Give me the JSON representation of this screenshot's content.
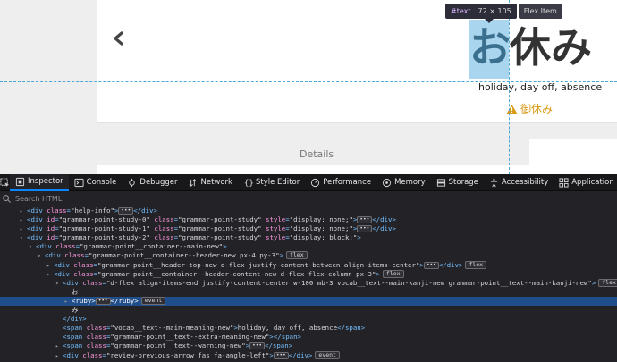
{
  "page": {
    "kanji_highlighted": "お",
    "kanji_rest": "休み",
    "meaning": "holiday, day off, absence",
    "warning_text": "御休み",
    "details_label": "Details",
    "back_icon": "chevron-left-icon",
    "warning_icon": "warning-triangle-icon",
    "colors": {
      "highlight": "#a9d6ee",
      "warning": "#d89a15",
      "guide": "#4aa7d8"
    }
  },
  "tooltip": {
    "node": "#text",
    "dimensions": "72 × 105",
    "flex_label": "Flex Item"
  },
  "devtools": {
    "tabs": [
      {
        "label": "Inspector",
        "icon": "inspector-icon",
        "active": true
      },
      {
        "label": "Console",
        "icon": "console-icon"
      },
      {
        "label": "Debugger",
        "icon": "debugger-icon"
      },
      {
        "label": "Network",
        "icon": "network-icon"
      },
      {
        "label": "Style Editor",
        "icon": "style-editor-icon"
      },
      {
        "label": "Performance",
        "icon": "performance-icon"
      },
      {
        "label": "Memory",
        "icon": "memory-icon"
      },
      {
        "label": "Storage",
        "icon": "storage-icon"
      },
      {
        "label": "Accessibility",
        "icon": "accessibility-icon"
      },
      {
        "label": "Application",
        "icon": "application-icon"
      }
    ],
    "search_placeholder": "Search HTML",
    "tree": [
      {
        "indent": 0,
        "tw": "▸",
        "parts": [
          [
            "t",
            "<div "
          ],
          [
            "a",
            "class"
          ],
          [
            "t",
            "="
          ],
          [
            "v",
            "\"help-info\""
          ],
          [
            "t",
            ">"
          ],
          [
            "d",
            ""
          ],
          [
            "t",
            "</div>"
          ]
        ]
      },
      {
        "indent": 0,
        "tw": "▸",
        "parts": [
          [
            "t",
            "<div "
          ],
          [
            "a",
            "id"
          ],
          [
            "t",
            "="
          ],
          [
            "v",
            "\"grammar-point-study-0\" "
          ],
          [
            "a",
            "class"
          ],
          [
            "t",
            "="
          ],
          [
            "v",
            "\"grammar-point-study\" "
          ],
          [
            "a",
            "style"
          ],
          [
            "t",
            "="
          ],
          [
            "v",
            "\"display: none;\""
          ],
          [
            "t",
            ">"
          ],
          [
            "d",
            ""
          ],
          [
            "t",
            "</div>"
          ]
        ]
      },
      {
        "indent": 0,
        "tw": "▸",
        "parts": [
          [
            "t",
            "<div "
          ],
          [
            "a",
            "id"
          ],
          [
            "t",
            "="
          ],
          [
            "v",
            "\"grammar-point-study-1\" "
          ],
          [
            "a",
            "class"
          ],
          [
            "t",
            "="
          ],
          [
            "v",
            "\"grammar-point-study\" "
          ],
          [
            "a",
            "style"
          ],
          [
            "t",
            "="
          ],
          [
            "v",
            "\"display: none;\""
          ],
          [
            "t",
            ">"
          ],
          [
            "d",
            ""
          ],
          [
            "t",
            "</div>"
          ]
        ]
      },
      {
        "indent": 0,
        "tw": "▾",
        "parts": [
          [
            "t",
            "<div "
          ],
          [
            "a",
            "id"
          ],
          [
            "t",
            "="
          ],
          [
            "v",
            "\"grammar-point-study-2\" "
          ],
          [
            "a",
            "class"
          ],
          [
            "t",
            "="
          ],
          [
            "v",
            "\"grammar-point-study\" "
          ],
          [
            "a",
            "style"
          ],
          [
            "t",
            "="
          ],
          [
            "v",
            "\"display: block;\""
          ],
          [
            "t",
            ">"
          ]
        ]
      },
      {
        "indent": 1,
        "tw": "▾",
        "parts": [
          [
            "t",
            "<div "
          ],
          [
            "a",
            "class"
          ],
          [
            "t",
            "="
          ],
          [
            "v",
            "\"grammar-point__container--main-new\""
          ],
          [
            "t",
            ">"
          ]
        ]
      },
      {
        "indent": 2,
        "tw": "▾",
        "parts": [
          [
            "t",
            "<div "
          ],
          [
            "a",
            "class"
          ],
          [
            "t",
            "="
          ],
          [
            "v",
            "\"grammar-point__container--header-new px-4 py-3\""
          ],
          [
            "t",
            ">"
          ],
          [
            "b",
            "flex"
          ]
        ]
      },
      {
        "indent": 3,
        "tw": "▸",
        "parts": [
          [
            "t",
            "<div "
          ],
          [
            "a",
            "class"
          ],
          [
            "t",
            "="
          ],
          [
            "v",
            "\"grammar-point__header-top-new d-flex justify-content-between align-items-center\""
          ],
          [
            "t",
            ">"
          ],
          [
            "d",
            ""
          ],
          [
            "t",
            "</div>"
          ],
          [
            "b",
            "flex"
          ]
        ]
      },
      {
        "indent": 3,
        "tw": "▾",
        "parts": [
          [
            "t",
            "<div "
          ],
          [
            "a",
            "class"
          ],
          [
            "t",
            "="
          ],
          [
            "v",
            "\"grammar-point__container--header-content-new d-flex flex-column px-3\""
          ],
          [
            "t",
            ">"
          ],
          [
            "b",
            "flex"
          ]
        ]
      },
      {
        "indent": 4,
        "tw": "▾",
        "parts": [
          [
            "t",
            "<div "
          ],
          [
            "a",
            "class"
          ],
          [
            "t",
            "="
          ],
          [
            "v",
            "\"d-flex align-items-end justify-content-center w-100 mb-3 vocab__text--main-kanji-new grammar-point__text--main-kanji-new\""
          ],
          [
            "t",
            ">"
          ],
          [
            "b",
            "flex"
          ]
        ]
      },
      {
        "indent": 5,
        "tw": "",
        "parts": [
          [
            "x",
            "お"
          ]
        ]
      },
      {
        "indent": 5,
        "tw": "▸",
        "selected": true,
        "parts": [
          [
            "t",
            "<ruby>"
          ],
          [
            "d",
            ""
          ],
          [
            "t",
            "</ruby>"
          ],
          [
            "b",
            "event"
          ]
        ]
      },
      {
        "indent": 5,
        "tw": "",
        "parts": [
          [
            "x",
            "み"
          ]
        ]
      },
      {
        "indent": 4,
        "tw": "",
        "parts": [
          [
            "t",
            "</div>"
          ]
        ]
      },
      {
        "indent": 4,
        "tw": "",
        "parts": [
          [
            "t",
            "<span "
          ],
          [
            "a",
            "class"
          ],
          [
            "t",
            "="
          ],
          [
            "v",
            "\"vocab__text--main-meaning-new\""
          ],
          [
            "t",
            ">"
          ],
          [
            "x",
            "holiday, day off, absence"
          ],
          [
            "t",
            "</span>"
          ]
        ]
      },
      {
        "indent": 4,
        "tw": "",
        "parts": [
          [
            "t",
            "<span "
          ],
          [
            "a",
            "class"
          ],
          [
            "t",
            "="
          ],
          [
            "v",
            "\"grammar-point__text--extra-meaning-new\""
          ],
          [
            "t",
            "></span>"
          ]
        ]
      },
      {
        "indent": 4,
        "tw": "▸",
        "parts": [
          [
            "t",
            "<span "
          ],
          [
            "a",
            "class"
          ],
          [
            "t",
            "="
          ],
          [
            "v",
            "\"grammar-point__text--warning-new\""
          ],
          [
            "t",
            ">"
          ],
          [
            "d",
            ""
          ],
          [
            "t",
            "</span>"
          ]
        ]
      },
      {
        "indent": 4,
        "tw": "▸",
        "parts": [
          [
            "t",
            "<div "
          ],
          [
            "a",
            "class"
          ],
          [
            "t",
            "="
          ],
          [
            "v",
            "\"review-previous-arrow fas fa-angle-left\""
          ],
          [
            "t",
            ">"
          ],
          [
            "d",
            ""
          ],
          [
            "t",
            "</div>"
          ],
          [
            "b",
            "event"
          ]
        ]
      }
    ]
  }
}
